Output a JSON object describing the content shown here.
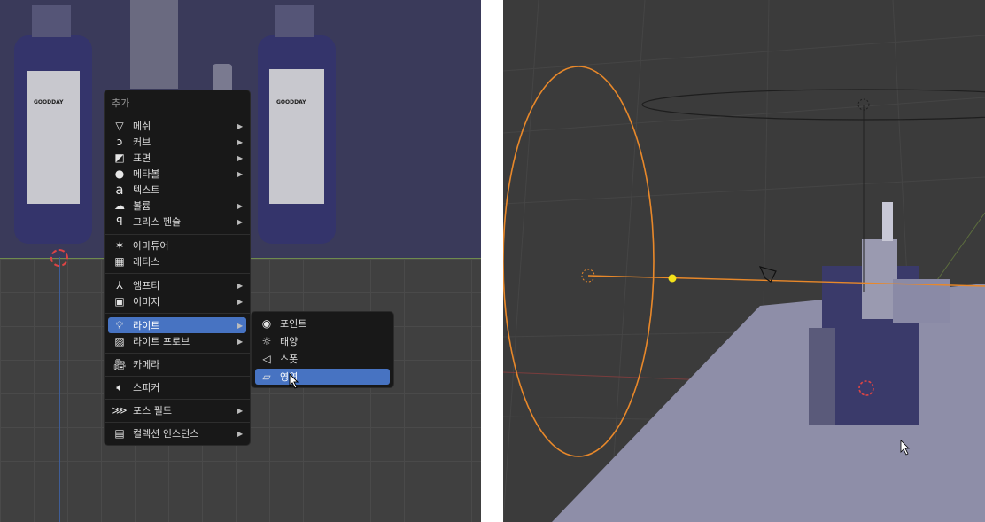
{
  "left_viewport": {
    "bottle_labels": [
      "GOODDAY",
      "GOODDAY"
    ],
    "add_menu": {
      "title": "추가",
      "items": [
        {
          "label": "메쉬",
          "icon": "mesh-icon",
          "submenu": true
        },
        {
          "label": "커브",
          "icon": "curve-icon",
          "submenu": true
        },
        {
          "label": "표면",
          "icon": "surface-icon",
          "submenu": true
        },
        {
          "label": "메타볼",
          "icon": "metaball-icon",
          "submenu": true
        },
        {
          "label": "텍스트",
          "icon": "text-icon",
          "submenu": false
        },
        {
          "label": "볼륨",
          "icon": "volume-icon",
          "submenu": true
        },
        {
          "label": "그리스 펜슬",
          "icon": "grease-pencil-icon",
          "submenu": true
        },
        {
          "label": "아마튜어",
          "icon": "armature-icon",
          "submenu": false
        },
        {
          "label": "래티스",
          "icon": "lattice-icon",
          "submenu": false
        },
        {
          "label": "엠프티",
          "icon": "empty-icon",
          "submenu": true
        },
        {
          "label": "이미지",
          "icon": "image-icon",
          "submenu": true
        },
        {
          "label": "라이트",
          "icon": "light-icon",
          "submenu": true,
          "highlighted": true
        },
        {
          "label": "라이트 프로브",
          "icon": "light-probe-icon",
          "submenu": true
        },
        {
          "label": "카메라",
          "icon": "camera-icon",
          "submenu": false
        },
        {
          "label": "스피커",
          "icon": "speaker-icon",
          "submenu": false
        },
        {
          "label": "포스 필드",
          "icon": "force-field-icon",
          "submenu": true
        },
        {
          "label": "컬렉션 인스턴스",
          "icon": "collection-instance-icon",
          "submenu": true
        }
      ]
    },
    "light_submenu": {
      "items": [
        {
          "label": "포인트",
          "icon": "point-light-icon"
        },
        {
          "label": "태양",
          "icon": "sun-light-icon"
        },
        {
          "label": "스폿",
          "icon": "spot-light-icon"
        },
        {
          "label": "영역",
          "icon": "area-light-icon",
          "highlighted": true
        }
      ]
    }
  },
  "colors": {
    "highlight": "#4773c2",
    "menu_bg": "#181818",
    "light_selected": "#e8882a"
  }
}
